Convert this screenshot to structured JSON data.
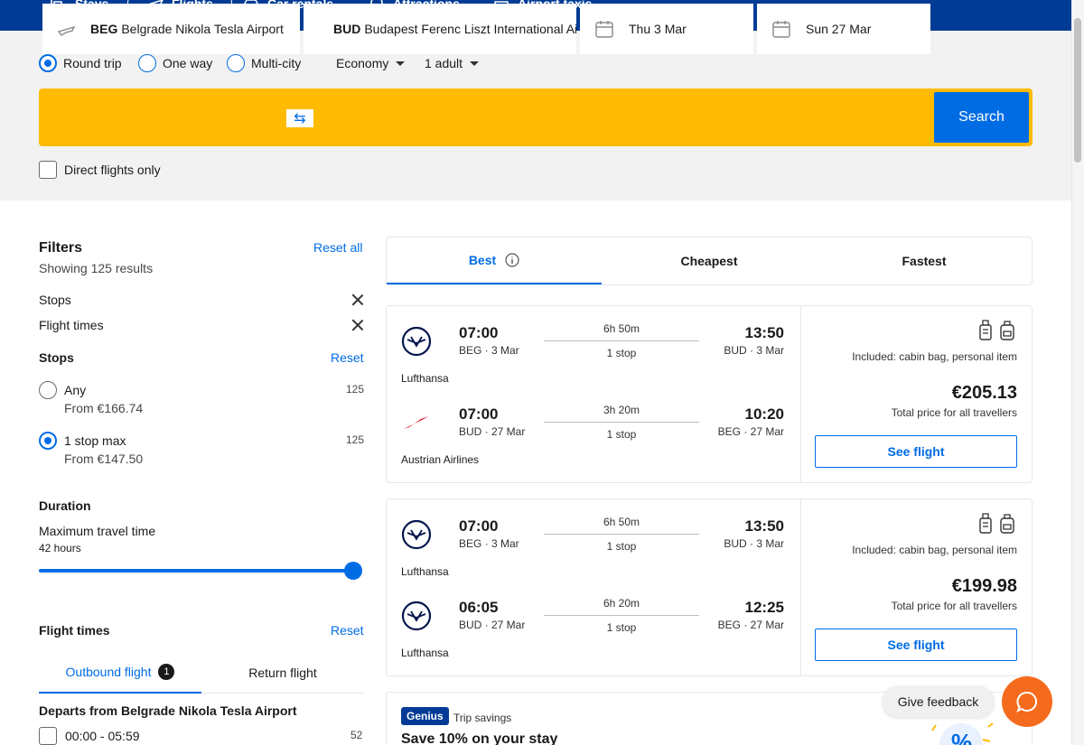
{
  "nav": {
    "items": [
      {
        "label": "Stays",
        "icon": "bed-icon"
      },
      {
        "label": "Flights",
        "icon": "plane-icon"
      },
      {
        "label": "Car rentals",
        "icon": "car-icon"
      },
      {
        "label": "Attractions",
        "icon": "attractions-icon"
      },
      {
        "label": "Airport taxis",
        "icon": "taxi-icon"
      }
    ],
    "active": "Flights",
    "bg_color": "#003b95"
  },
  "search": {
    "trip_types": [
      "Round trip",
      "One way",
      "Multi-city"
    ],
    "selected_trip_type": "Round trip",
    "cabin_class": "Economy",
    "passengers": "1 adult",
    "from_code": "BEG",
    "from_name": "Belgrade Nikola Tesla Airport",
    "to_code": "BUD",
    "to_name": "Budapest Ferenc Liszt International Airport",
    "depart_date": "Thu 3 Mar",
    "return_date": "Sun 27 Mar",
    "search_label": "Search",
    "direct_only_label": "Direct flights only",
    "accent_color": "#febb02"
  },
  "filters": {
    "title": "Filters",
    "reset_all": "Reset all",
    "showing": "Showing 125 results",
    "applied": [
      "Stops",
      "Flight times"
    ],
    "stops": {
      "title": "Stops",
      "reset": "Reset",
      "options": [
        {
          "label": "Any",
          "from": "From €166.74",
          "count": "125",
          "selected": false
        },
        {
          "label": "1 stop max",
          "from": "From €147.50",
          "count": "125",
          "selected": true
        }
      ]
    },
    "duration": {
      "title": "Duration",
      "max_label": "Maximum travel time",
      "max_value": "42 hours",
      "slider_fraction": 1.0
    },
    "flight_times": {
      "title": "Flight times",
      "reset": "Reset",
      "tabs": [
        "Outbound flight",
        "Return flight"
      ],
      "outbound_badge": "1",
      "departs_from": "Departs from Belgrade Nikola Tesla Airport",
      "slots": [
        {
          "label": "00:00 - 05:59",
          "count": "52"
        }
      ]
    }
  },
  "sort_tabs": [
    {
      "label": "Best",
      "active": true,
      "info_icon": true
    },
    {
      "label": "Cheapest",
      "active": false
    },
    {
      "label": "Fastest",
      "active": false
    }
  ],
  "results": [
    {
      "legs": [
        {
          "depart": "07:00",
          "depart_sub": "BEG · 3 Mar",
          "duration": "6h 50m",
          "stops": "1 stop",
          "arrive": "13:50",
          "arrive_sub": "BUD · 3 Mar",
          "airline": "Lufthansa",
          "logo": "lufthansa-logo-icon"
        },
        {
          "depart": "07:00",
          "depart_sub": "BUD · 27 Mar",
          "duration": "3h 20m",
          "stops": "1 stop",
          "arrive": "10:20",
          "arrive_sub": "BEG · 27 Mar",
          "airline": "Austrian Airlines",
          "logo": "austrian-logo-icon"
        }
      ],
      "included": "Included: cabin bag, personal item",
      "price": "€205.13",
      "price_sub": "Total price for all travellers",
      "cta": "See flight"
    },
    {
      "legs": [
        {
          "depart": "07:00",
          "depart_sub": "BEG · 3 Mar",
          "duration": "6h 50m",
          "stops": "1 stop",
          "arrive": "13:50",
          "arrive_sub": "BUD · 3 Mar",
          "airline": "Lufthansa",
          "logo": "lufthansa-logo-icon"
        },
        {
          "depart": "06:05",
          "depart_sub": "BUD · 27 Mar",
          "duration": "6h 20m",
          "stops": "1 stop",
          "arrive": "12:25",
          "arrive_sub": "BEG · 27 Mar",
          "airline": "Lufthansa",
          "logo": "lufthansa-logo-icon"
        }
      ],
      "included": "Included: cabin bag, personal item",
      "price": "€199.98",
      "price_sub": "Total price for all travellers",
      "cta": "See flight"
    }
  ],
  "genius": {
    "badge": "Genius",
    "label": "Trip savings",
    "headline": "Save 10% on your stay"
  },
  "feedback_label": "Give feedback",
  "brand_blue": "#006ce4"
}
